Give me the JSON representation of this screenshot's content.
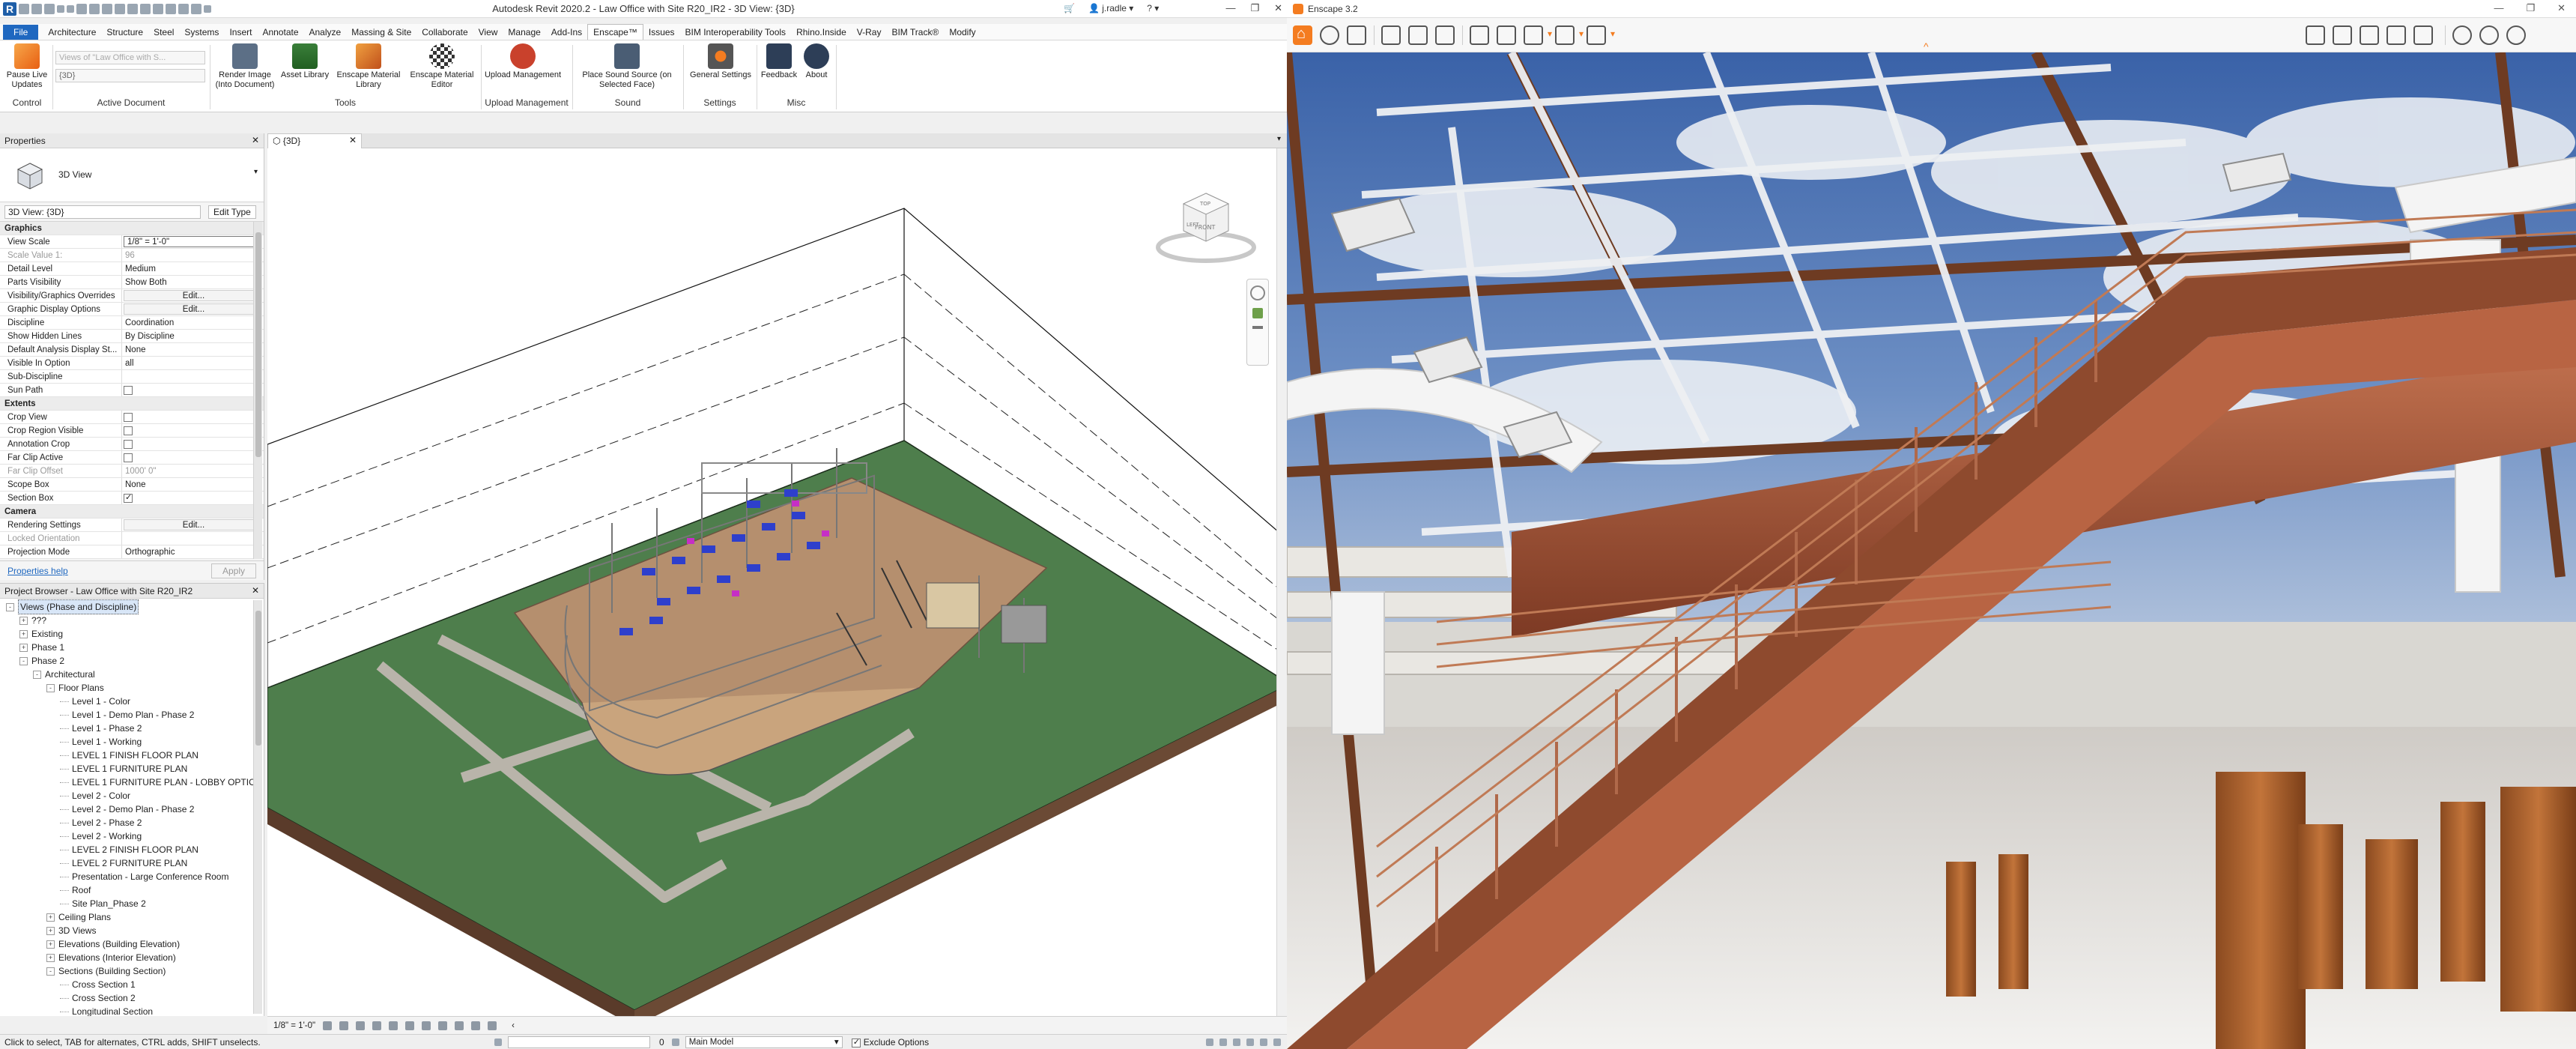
{
  "revit": {
    "title": "Autodesk Revit 2020.2 - Law Office with Site R20_IR2 - 3D View: {3D}",
    "user": "j.radle",
    "menu_tabs": [
      "File",
      "Architecture",
      "Structure",
      "Steel",
      "Systems",
      "Insert",
      "Annotate",
      "Analyze",
      "Massing & Site",
      "Collaborate",
      "View",
      "Manage",
      "Add-Ins",
      "Enscape™",
      "Issues",
      "BIM Interoperability Tools",
      "Rhino.Inside",
      "V-Ray",
      "BIM Track®",
      "Modify"
    ],
    "active_tab": "Enscape™",
    "ribbon": {
      "pause_live": "Pause Live Updates",
      "views_placeholder": "Views of \"Law Office with S...",
      "view_select": "{3D}",
      "render_image": "Render Image (Into Document)",
      "asset_library": "Asset Library",
      "material_library": "Enscape Material Library",
      "material_editor": "Enscape Material Editor",
      "upload_management": "Upload Management",
      "place_sound": "Place Sound Source (on Selected Face)",
      "general_settings": "General Settings",
      "feedback": "Feedback",
      "about": "About",
      "groups": {
        "control": "Control",
        "active_document": "Active Document",
        "tools": "Tools",
        "upload_management": "Upload Management",
        "sound": "Sound",
        "settings": "Settings",
        "misc": "Misc"
      }
    },
    "properties": {
      "title": "Properties",
      "type_name": "3D View",
      "selector": "3D View: {3D}",
      "edit_type": "Edit Type",
      "help_link": "Properties help",
      "apply": "Apply",
      "rows": [
        {
          "section": "Graphics"
        },
        {
          "k": "View Scale",
          "v": "1/8\" = 1'-0\"",
          "kind": "input"
        },
        {
          "k": "Scale Value    1:",
          "v": "96",
          "kind": "grey"
        },
        {
          "k": "Detail Level",
          "v": "Medium"
        },
        {
          "k": "Parts Visibility",
          "v": "Show Both"
        },
        {
          "k": "Visibility/Graphics Overrides",
          "v": "Edit...",
          "kind": "btn"
        },
        {
          "k": "Graphic Display Options",
          "v": "Edit...",
          "kind": "btn"
        },
        {
          "k": "Discipline",
          "v": "Coordination"
        },
        {
          "k": "Show Hidden Lines",
          "v": "By Discipline"
        },
        {
          "k": "Default Analysis Display St...",
          "v": "None"
        },
        {
          "k": "Visible In Option",
          "v": "all"
        },
        {
          "k": "Sub-Discipline",
          "v": ""
        },
        {
          "k": "Sun Path",
          "v": "",
          "kind": "chk"
        },
        {
          "section": "Extents"
        },
        {
          "k": "Crop View",
          "v": "",
          "kind": "chk"
        },
        {
          "k": "Crop Region Visible",
          "v": "",
          "kind": "chk"
        },
        {
          "k": "Annotation Crop",
          "v": "",
          "kind": "chk"
        },
        {
          "k": "Far Clip Active",
          "v": "",
          "kind": "chk"
        },
        {
          "k": "Far Clip Offset",
          "v": "1000' 0\"",
          "kind": "grey"
        },
        {
          "k": "Scope Box",
          "v": "None"
        },
        {
          "k": "Section Box",
          "v": "",
          "kind": "chk-on"
        },
        {
          "section": "Camera"
        },
        {
          "k": "Rendering Settings",
          "v": "Edit...",
          "kind": "btn"
        },
        {
          "k": "Locked Orientation",
          "v": "",
          "kind": "grey"
        },
        {
          "k": "Projection Mode",
          "v": "Orthographic"
        }
      ]
    },
    "browser": {
      "title": "Project Browser - Law Office with Site R20_IR2",
      "nodes": [
        {
          "label": "Views (Phase and Discipline)",
          "depth": 0,
          "toggle": "-",
          "selected": true
        },
        {
          "label": "???",
          "depth": 1,
          "toggle": "+"
        },
        {
          "label": "Existing",
          "depth": 1,
          "toggle": "+"
        },
        {
          "label": "Phase 1",
          "depth": 1,
          "toggle": "+"
        },
        {
          "label": "Phase 2",
          "depth": 1,
          "toggle": "-"
        },
        {
          "label": "Architectural",
          "depth": 2,
          "toggle": "-"
        },
        {
          "label": "Floor Plans",
          "depth": 3,
          "toggle": "-"
        },
        {
          "label": "Level 1 - Color",
          "depth": 4
        },
        {
          "label": "Level 1 - Demo Plan - Phase 2",
          "depth": 4
        },
        {
          "label": "Level 1 - Phase 2",
          "depth": 4
        },
        {
          "label": "Level 1 - Working",
          "depth": 4
        },
        {
          "label": "LEVEL 1 FINISH FLOOR PLAN",
          "depth": 4
        },
        {
          "label": "LEVEL 1 FURNITURE PLAN",
          "depth": 4
        },
        {
          "label": "LEVEL 1 FURNITURE PLAN - LOBBY OPTION",
          "depth": 4
        },
        {
          "label": "Level 2 - Color",
          "depth": 4
        },
        {
          "label": "Level 2 - Demo Plan - Phase 2",
          "depth": 4
        },
        {
          "label": "Level 2 - Phase 2",
          "depth": 4
        },
        {
          "label": "Level 2 - Working",
          "depth": 4
        },
        {
          "label": "LEVEL 2 FINISH FLOOR PLAN",
          "depth": 4
        },
        {
          "label": "LEVEL 2 FURNITURE PLAN",
          "depth": 4
        },
        {
          "label": "Presentation - Large Conference Room",
          "depth": 4
        },
        {
          "label": "Roof",
          "depth": 4
        },
        {
          "label": "Site Plan_Phase 2",
          "depth": 4
        },
        {
          "label": "Ceiling Plans",
          "depth": 3,
          "toggle": "+"
        },
        {
          "label": "3D Views",
          "depth": 3,
          "toggle": "+"
        },
        {
          "label": "Elevations (Building Elevation)",
          "depth": 3,
          "toggle": "+"
        },
        {
          "label": "Elevations (Interior Elevation)",
          "depth": 3,
          "toggle": "+"
        },
        {
          "label": "Sections (Building Section)",
          "depth": 3,
          "toggle": "-"
        },
        {
          "label": "Cross Section 1",
          "depth": 4
        },
        {
          "label": "Cross Section 2",
          "depth": 4
        },
        {
          "label": "Longitudinal Section",
          "depth": 4
        }
      ]
    },
    "view_tab": "{3D}",
    "view_scale": "1/8\" = 1'-0\"",
    "status": "Click to select, TAB for alternates, CTRL adds, SHIFT unselects.",
    "workset": "Main Model",
    "exclude_options": "Exclude Options",
    "status_value": "0"
  },
  "enscape": {
    "title": "Enscape 3.2"
  }
}
